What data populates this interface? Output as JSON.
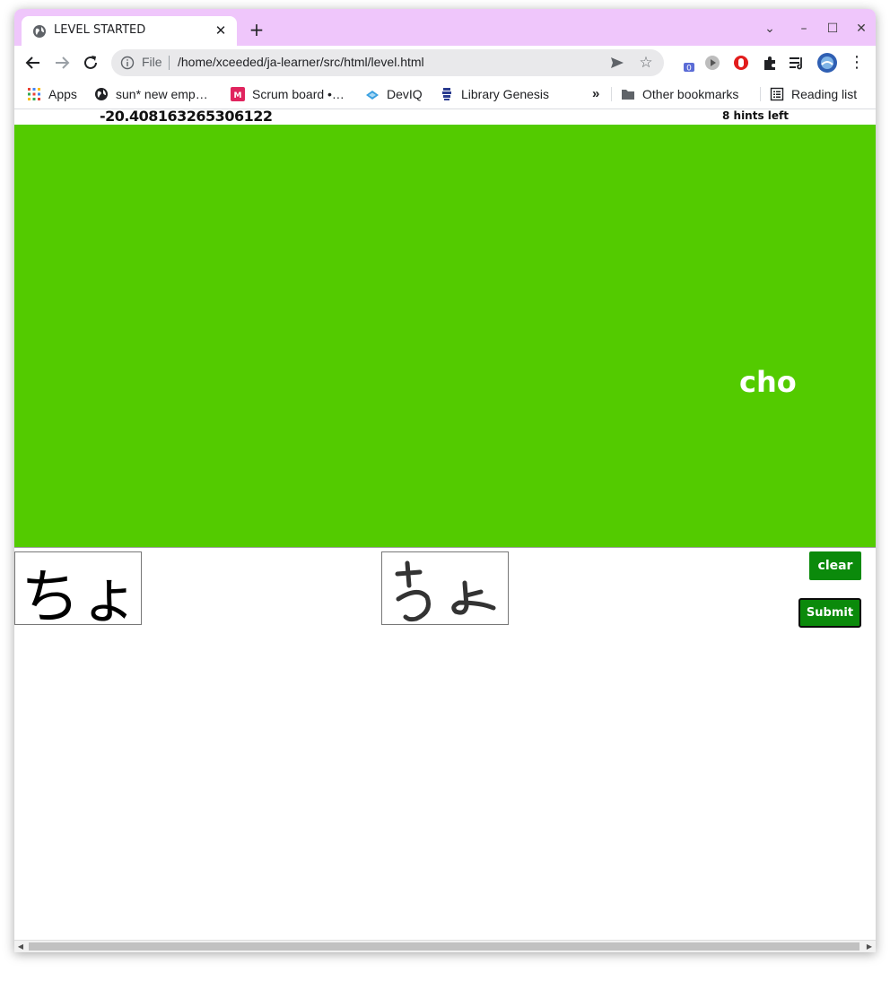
{
  "browser": {
    "tab_title": "LEVEL STARTED",
    "tab_close": "✕",
    "new_tab": "+",
    "window_controls": {
      "dropdown": "⌄",
      "minimize": "–",
      "maximize": "☐",
      "close": "✕"
    },
    "address": {
      "scheme_label": "File",
      "url": "/home/xceeded/ja-learner/src/html/level.html"
    },
    "extension_badge": "0",
    "bookmarks": [
      {
        "label": "Apps",
        "icon": "apps-grid-icon"
      },
      {
        "label": "sun* new emp…",
        "icon": "globe-icon"
      },
      {
        "label": "Scrum board •…",
        "icon": "m-logo-icon"
      },
      {
        "label": "DevIQ",
        "icon": "deviq-icon"
      },
      {
        "label": "Library Genesis",
        "icon": "libgen-icon"
      }
    ],
    "bookmarks_overflow": "»",
    "other_bookmarks": "Other bookmarks",
    "reading_list": "Reading list"
  },
  "game": {
    "score": "-20.408163265306122",
    "hints": "8 hints left",
    "prompt_romaji": "cho",
    "reference_kana": "ちょ",
    "clear_label": "clear",
    "submit_label": "Submit"
  },
  "colors": {
    "titlebar": "#efc6fb",
    "stage": "#53cb00",
    "button": "#0b8a0b"
  }
}
